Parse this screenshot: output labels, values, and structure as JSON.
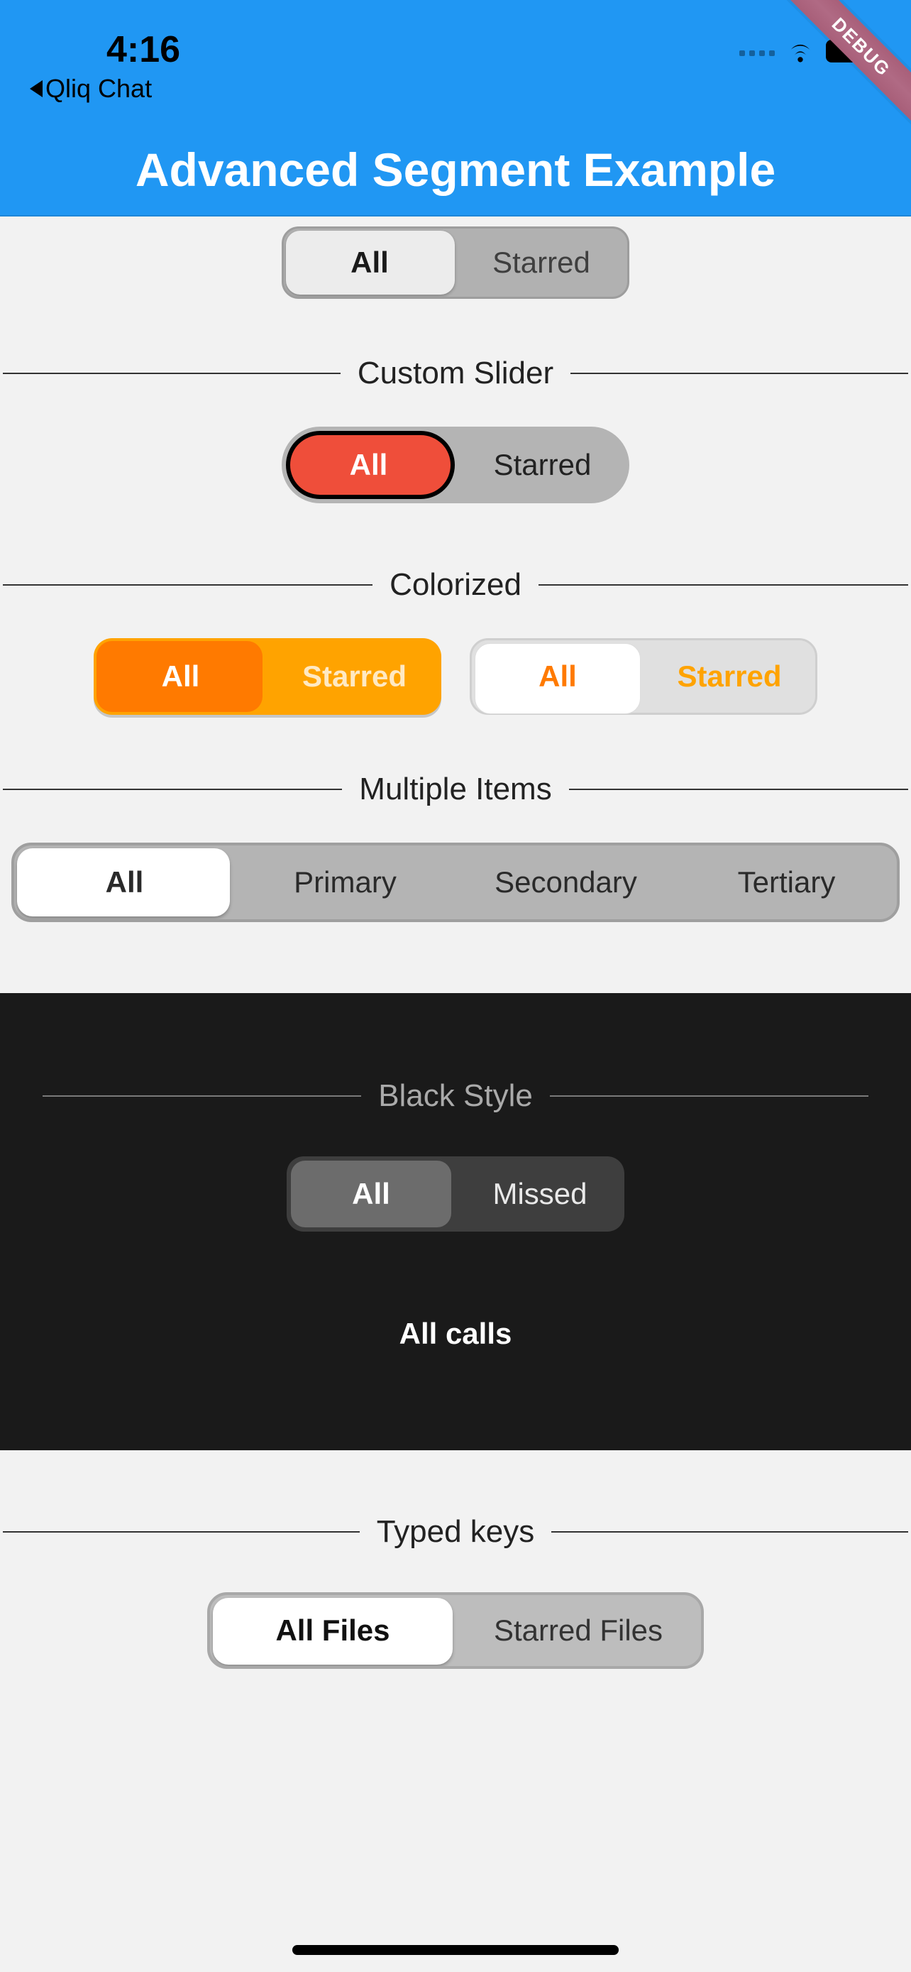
{
  "status": {
    "time": "4:16",
    "back_app": "Qliq Chat",
    "debug_tag": "DEBUG"
  },
  "nav": {
    "title": "Advanced Segment Example"
  },
  "segments": {
    "top": {
      "options": [
        "All",
        "Starred"
      ],
      "selected": 0
    },
    "custom_slider": {
      "heading": "Custom Slider",
      "options": [
        "All",
        "Starred"
      ],
      "selected": 0,
      "pill_color": "#ef4e3a"
    },
    "colorized": {
      "heading": "Colorized",
      "left": {
        "options": [
          "All",
          "Starred"
        ],
        "selected": 0,
        "track_color": "#ffa300",
        "pill_color": "#ff7a00"
      },
      "right": {
        "options": [
          "All",
          "Starred"
        ],
        "selected": 0,
        "track_color": "#e0e0e0",
        "pill_color": "#ffffff",
        "text_color": "#ff7a00"
      }
    },
    "multiple": {
      "heading": "Multiple Items",
      "options": [
        "All",
        "Primary",
        "Secondary",
        "Tertiary"
      ],
      "selected": 0
    },
    "black": {
      "heading": "Black Style",
      "options": [
        "All",
        "Missed"
      ],
      "selected": 0,
      "body_text": "All calls"
    },
    "typed": {
      "heading": "Typed keys",
      "options": [
        "All Files",
        "Starred Files"
      ],
      "selected": 0
    }
  }
}
